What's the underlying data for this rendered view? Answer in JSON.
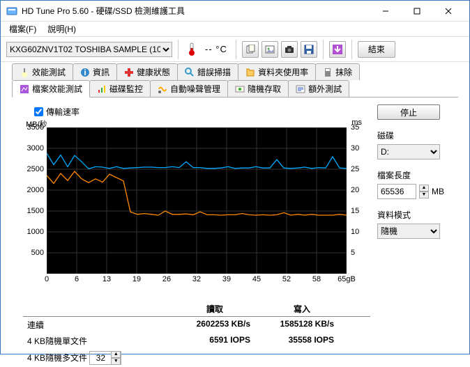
{
  "window": {
    "title": "HD Tune Pro 5.60 - 硬碟/SSD 檢測維護工具"
  },
  "menu": {
    "file": "檔案(F)",
    "help": "說明(H)"
  },
  "toolbar": {
    "drive": "KXG60ZNV1T02 TOSHIBA SAMPLE (10",
    "temp": "-- °C",
    "exit": "結束"
  },
  "tabs_row1": [
    {
      "label": "效能測試"
    },
    {
      "label": "資訊"
    },
    {
      "label": "健康狀態"
    },
    {
      "label": "錯誤掃描"
    },
    {
      "label": "資料夾使用率"
    },
    {
      "label": "抹除"
    }
  ],
  "tabs_row2": [
    {
      "label": "檔案效能測試",
      "active": true
    },
    {
      "label": "磁碟監控"
    },
    {
      "label": "自動噪聲管理"
    },
    {
      "label": "隨機存取"
    },
    {
      "label": "額外測試"
    }
  ],
  "checkbox": {
    "label": "傳輸速率",
    "checked": true
  },
  "chart_data": {
    "type": "line",
    "x_max_label": "65gB",
    "x_ticks": [
      "0",
      "6",
      "13",
      "19",
      "26",
      "32",
      "39",
      "45",
      "52",
      "58",
      "65gB"
    ],
    "y_left_label": "MB/秒",
    "y_left_ticks": [
      "3500",
      "3000",
      "2500",
      "2000",
      "1500",
      "1000",
      "500"
    ],
    "y_left_lim": [
      0,
      3500
    ],
    "y_right_label": "ms",
    "y_right_ticks": [
      "35",
      "30",
      "25",
      "20",
      "15",
      "10",
      "5"
    ],
    "y_right_lim": [
      0,
      35
    ],
    "series": [
      {
        "name": "read",
        "color": "#00aaff",
        "values": [
          2880,
          2610,
          2840,
          2560,
          2830,
          2680,
          2510,
          2560,
          2550,
          2520,
          2560,
          2520,
          2530,
          2540,
          2550,
          2550,
          2540,
          2540,
          2560,
          2540,
          2680,
          2540,
          2540,
          2520,
          2520,
          2530,
          2560,
          2520,
          2530,
          2530,
          2560,
          2530,
          2530,
          2730,
          2530,
          2520,
          2530,
          2550,
          2520,
          2540,
          2530,
          2800,
          2530,
          2520
        ]
      },
      {
        "name": "write",
        "color": "#ff8800",
        "values": [
          2350,
          2160,
          2400,
          2230,
          2450,
          2270,
          2180,
          2270,
          2190,
          2380,
          2300,
          2220,
          1480,
          1420,
          1440,
          1420,
          1400,
          1500,
          1420,
          1420,
          1430,
          1410,
          1480,
          1410,
          1410,
          1400,
          1410,
          1410,
          1440,
          1410,
          1400,
          1410,
          1400,
          1410,
          1460,
          1400,
          1420,
          1400,
          1420,
          1400,
          1400,
          1400,
          1420,
          1400
        ]
      }
    ]
  },
  "table": {
    "head_read": "讀取",
    "head_write": "寫入",
    "rows": [
      {
        "label": "連續",
        "read": "2602253 KB/s",
        "write": "1585128 KB/s"
      },
      {
        "label": "4 KB隨機單文件",
        "read": "6591 IOPS",
        "write": "35558 IOPS"
      },
      {
        "label": "4 KB隨機多文件",
        "spinner": "32"
      }
    ]
  },
  "right": {
    "stop": "停止",
    "disk_label": "磁碟",
    "disk_value": "D:",
    "len_label": "檔案長度",
    "len_value": "65536",
    "len_unit": "MB",
    "mode_label": "資料模式",
    "mode_value": "隨機"
  }
}
